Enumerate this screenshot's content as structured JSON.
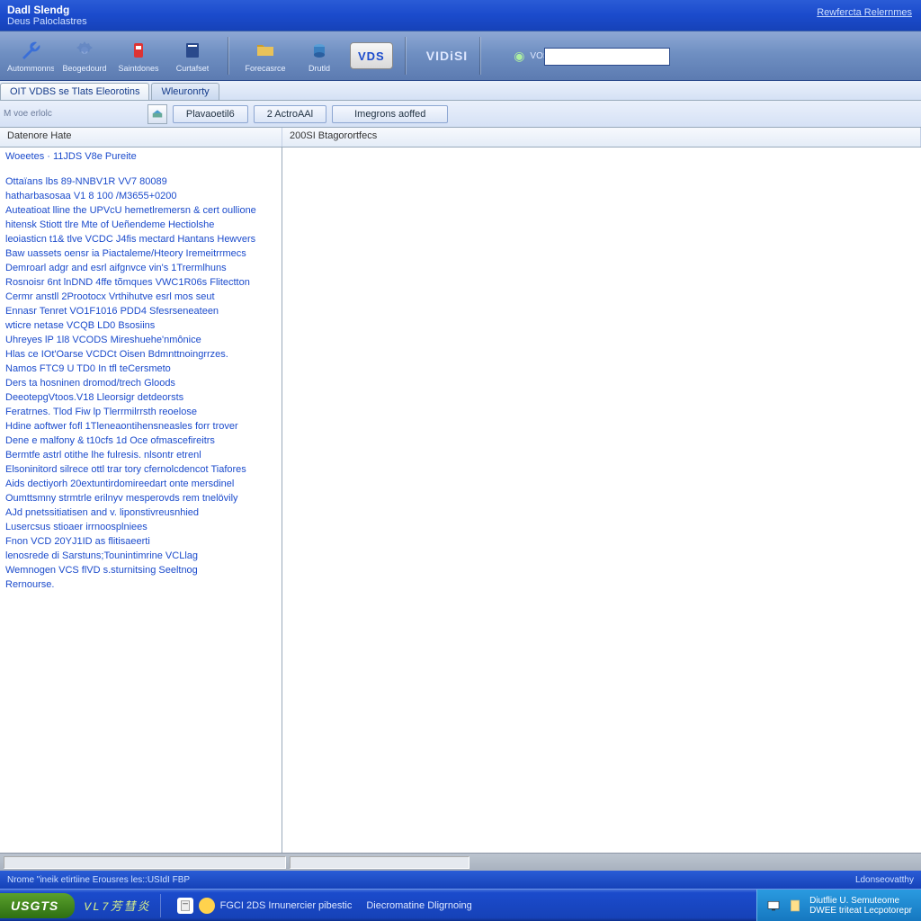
{
  "titlebar": {
    "line1": "Dadl Slendg",
    "line2": "Deus Paloclastres",
    "right_link": "Rewfercta Relernmes"
  },
  "toolbar": {
    "buttons_left": [
      {
        "label": "Autommonns",
        "icon": "wrench-icon"
      },
      {
        "label": "Beogedourd",
        "icon": "gear-icon"
      },
      {
        "label": "Saintdones",
        "icon": "canister-icon"
      },
      {
        "label": "Curtafset",
        "icon": "book-icon"
      }
    ],
    "buttons_mid": [
      {
        "label": "Forecasrce",
        "icon": "folder-icon"
      },
      {
        "label": "Drutld",
        "icon": "drum-icon"
      }
    ],
    "vds_badge": "VDS",
    "vds_text": "VIDiSI",
    "search_label": "VOSEI Sauatoes",
    "search_value": ""
  },
  "tabs": [
    {
      "label": "OIT VDBS se Tlats Eleorotins",
      "active": true
    },
    {
      "label": "Wleuronrty",
      "active": false
    }
  ],
  "filter": {
    "label": "M voe erlolc",
    "buttons": [
      "Plavaoetil6",
      "2 ActroAAl",
      "Imegrons aoffed"
    ]
  },
  "columns": {
    "left": "Datenore Hate",
    "right": "200SI Btagorortfecs"
  },
  "left_pane": {
    "title": "Woeetes · 11JDS V8e Pureite",
    "lines": [
      "Ottaïans lbs 89-NNBV1R VV7 80089",
      "hatharbasosaa V1 8 100 /M3655+0200",
      "Auteatioat lline the UPVcU hemetlremersn & cert oullione",
      "hitensk Stiott tlre Mte of Ueñendeme Hectiolshe",
      "leoiasticn t1& tlve VCDC J4fis mectard Hantans Hewvers",
      "Baw uassets oensr ia Piactaleme/Hteory Iremeitrrmecs",
      "Demroarl adgr and esrl aifgnvce vin's 1Trermlhuns",
      "Rosnoisr 6nt lnDND 4ffe tõmques VWC1R06s Flitectton",
      "Cermr anstll 2Prootocx Vrthihutve esrl mos seut",
      "Ennasr Tenret VO1F1016 PDD4 Sfesrseneateen",
      "wticre netase  VCQB LD0 Bsosiins",
      "Uhreyes lP 1l8 VCODS Mireshuehe'nmônice",
      "Hlas ce IOt'Oarse VCDCt Oisen Bdmnttnoingrrzes.",
      "Namos FTC9 U TD0 In tfl teCersmeto",
      "Ders ta hosninen dromod/trech Gloods",
      "DeeotepgVtoos.V18 Lleorsigr detdeorsts",
      "Feratrnes. Tlod Fiw lp Tlerrmilrrsth reoelose",
      "Hdine aoftwer fofl 1Tleneaontihensneasles forr trover",
      "Dene e malfony & t10cfs 1d Oce ofmascefireitrs",
      "Bermtfe astrl otithe lhe fulresis. nlsontr etrenl",
      "Elsoninitord silrece ottl trar tory cfernolcdencot Tiafores",
      "Aids dectiyorh 20extuntirdomireedart onte mersdinel",
      "Oumttsmny strmtrle erilnyv mesperovds rem tnelövily",
      "AJd pnetssitiatisen and v. liponstivreusnhied",
      "Lusercsus stioaer irrnoosplniees",
      "Fnon VCD 20YJ1ID as flitisaeerti",
      "lenosrede di Sarstuns;Tounintimrine VCLlag",
      "Wemnogen VCS flVD s.sturnitsing Seeltnog",
      "Rernourse."
    ]
  },
  "bluebar": {
    "left": "Nrome \"ineik etirtiine Erousres les::USIdI FBP",
    "right": "Ldonseovatthy"
  },
  "taskbar": {
    "start": "USGTS",
    "version": "VL7芳彗炎",
    "items": [
      {
        "label": "FGCI 2DS Irnunercier pibestic",
        "icon": "doc-icon"
      },
      {
        "label": "Diecromatine Dligrnoing",
        "icon": "wave-icon"
      }
    ],
    "tray": {
      "line1": "Diutflie U. Semuteome",
      "line2": "DWEE triteat Lecpotorepr"
    }
  }
}
